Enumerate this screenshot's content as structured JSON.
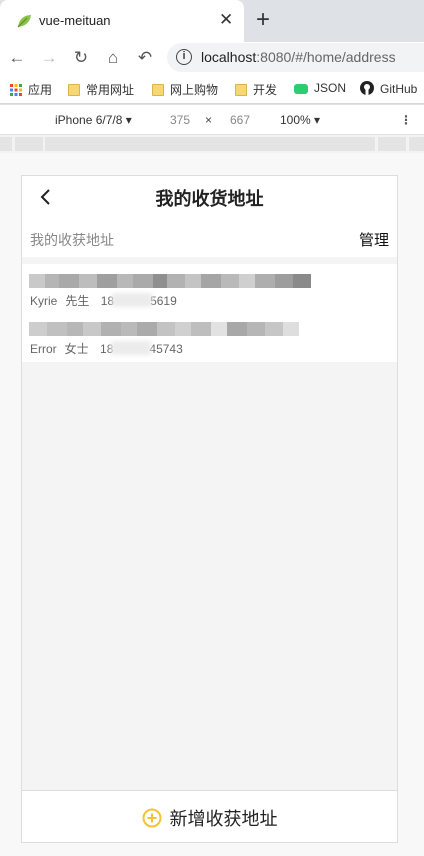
{
  "browser": {
    "tab_title": "vue-meituan",
    "url_host": "localhost",
    "url_rest": ":8080/#/home/address",
    "bookmarks": [
      {
        "label": "应用",
        "icon": "apps-grid-icon"
      },
      {
        "label": "常用网址",
        "icon": "folder-icon"
      },
      {
        "label": "网上购物",
        "icon": "folder-icon"
      },
      {
        "label": "开发",
        "icon": "folder-icon"
      },
      {
        "label": "JSON",
        "icon": "json-icon"
      },
      {
        "label": "GitHub",
        "icon": "github-icon"
      }
    ]
  },
  "devtools": {
    "device": "iPhone 6/7/8 ▾",
    "width": "375",
    "times": "×",
    "height": "667",
    "zoom": "100% ▾"
  },
  "page": {
    "title": "我的收货地址",
    "section_label": "我的收获地址",
    "manage_label": "管理",
    "addresses": [
      {
        "name": "Kyrie",
        "title": "先生",
        "phone_prefix": "18",
        "phone_suffix": "5619"
      },
      {
        "name": "Error",
        "title": "女士",
        "phone_prefix": "18",
        "phone_suffix": "45743"
      }
    ],
    "add_button": "新增收获地址"
  },
  "colors": {
    "accent": "#f5c332"
  }
}
